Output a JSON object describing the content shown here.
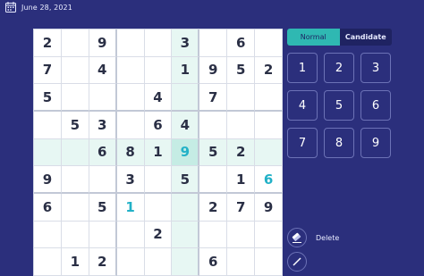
{
  "header": {
    "date": "June 28, 2021"
  },
  "board": {
    "rows": [
      [
        "2",
        "",
        "9",
        "",
        "",
        "3",
        "",
        "6",
        ""
      ],
      [
        "7",
        "",
        "4",
        "",
        "",
        "1",
        "9",
        "5",
        "2"
      ],
      [
        "5",
        "",
        "",
        "",
        "4",
        "",
        "7",
        "",
        ""
      ],
      [
        "",
        "5",
        "3",
        "",
        "6",
        "4",
        "",
        "",
        ""
      ],
      [
        "",
        "",
        "6",
        "8",
        "1",
        "9",
        "5",
        "2",
        ""
      ],
      [
        "9",
        "",
        "",
        "3",
        "",
        "5",
        "",
        "1",
        "6"
      ],
      [
        "6",
        "",
        "5",
        "1",
        "",
        "",
        "2",
        "7",
        "9"
      ],
      [
        "",
        "",
        "",
        "",
        "2",
        "",
        "",
        "",
        ""
      ],
      [
        "",
        "1",
        "2",
        "",
        "",
        "",
        "6",
        "",
        ""
      ]
    ],
    "selected_row": 4,
    "selected_col": 5,
    "user_entries": [
      [
        5,
        8
      ],
      [
        6,
        3
      ]
    ]
  },
  "controls": {
    "mode_tabs": [
      "Normal",
      "Candidate"
    ],
    "active_mode": "Normal",
    "keypad": [
      "1",
      "2",
      "3",
      "4",
      "5",
      "6",
      "7",
      "8",
      "9"
    ],
    "delete_label": "Delete"
  },
  "colors": {
    "background": "#2b2f7c",
    "accent": "#2fb8b2",
    "user_digit": "#22b1c7",
    "highlight": "#e7f7f3"
  }
}
